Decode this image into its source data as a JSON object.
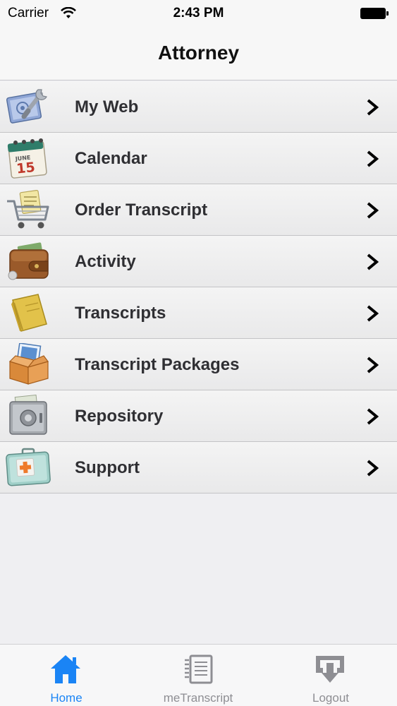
{
  "status_bar": {
    "carrier": "Carrier",
    "time": "2:43 PM"
  },
  "nav": {
    "title": "Attorney"
  },
  "menu": [
    {
      "label": "My Web",
      "icon": "web-wrench-icon"
    },
    {
      "label": "Calendar",
      "icon": "calendar-icon",
      "calendar_month": "JUNE",
      "calendar_day": "15"
    },
    {
      "label": "Order Transcript",
      "icon": "shopping-cart-icon"
    },
    {
      "label": "Activity",
      "icon": "wallet-icon"
    },
    {
      "label": "Transcripts",
      "icon": "notebook-icon"
    },
    {
      "label": "Transcript Packages",
      "icon": "package-box-icon"
    },
    {
      "label": "Repository",
      "icon": "safe-icon"
    },
    {
      "label": "Support",
      "icon": "first-aid-kit-icon"
    }
  ],
  "tabs": [
    {
      "label": "Home",
      "icon": "home-icon",
      "active": true
    },
    {
      "label": "meTranscript",
      "icon": "document-icon",
      "active": false
    },
    {
      "label": "Logout",
      "icon": "logout-icon",
      "active": false
    }
  ],
  "colors": {
    "tab_active": "#1a84f5",
    "tab_inactive": "#8e8e93",
    "menu_text": "#2f2f33",
    "background": "#efeff2"
  }
}
